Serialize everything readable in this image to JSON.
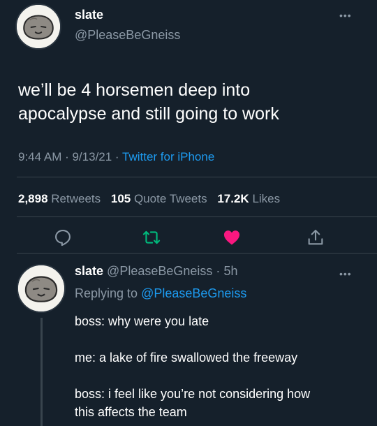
{
  "tweet": {
    "display_name": "slate",
    "handle": "@PleaseBeGneiss",
    "text_lines": [
      "we’ll be 4 horsemen deep into",
      "apocalypse and still going to work"
    ],
    "timestamp": "9:44 AM · 9/13/21 · ",
    "source": "Twitter for iPhone",
    "more_icon": "more-dots-icon"
  },
  "stats": {
    "retweets_count": "2,898",
    "retweets_label": "Retweets",
    "quotes_count": "105",
    "quotes_label": "Quote Tweets",
    "likes_count": "17.2K",
    "likes_label": "Likes"
  },
  "actions": {
    "icons": [
      "reply-icon",
      "retweet-icon",
      "like-icon",
      "share-icon"
    ],
    "colors": {
      "reply": "#8b98a5",
      "retweet": "#00ba7c",
      "like": "#f91880",
      "share": "#8b98a5"
    }
  },
  "reply": {
    "display_name": "slate",
    "handle": "@PleaseBeGneiss",
    "separator": "·",
    "time_ago": "5h",
    "replying_to_label": "Replying to",
    "replying_to_handle": "@PleaseBeGneiss",
    "lines": [
      "boss: why were you late",
      "me: a lake of fire swallowed the freeway",
      "boss: i feel like you’re not considering how",
      "this affects the team"
    ]
  },
  "theme": {
    "background": "#15202b",
    "text": "#ffffff",
    "secondary": "#8b98a5",
    "accent": "#1d9bf0",
    "divider": "#38444d"
  }
}
